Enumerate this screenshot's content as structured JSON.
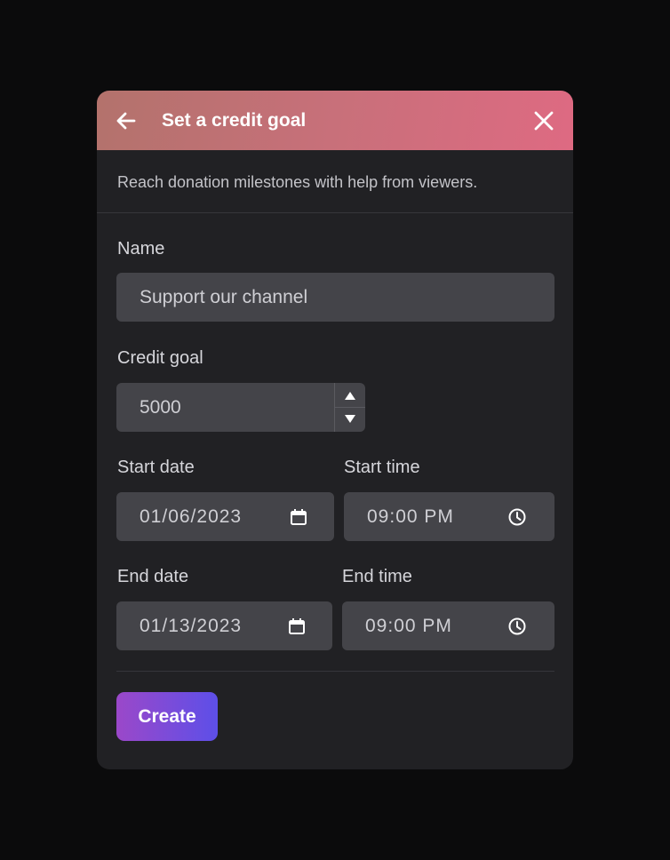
{
  "dialog": {
    "title": "Set a credit goal",
    "description": "Reach donation milestones with help from viewers.",
    "back_icon": "arrow-left-icon",
    "close_icon": "close-icon"
  },
  "form": {
    "name": {
      "label": "Name",
      "value": "Support our channel"
    },
    "credit_goal": {
      "label": "Credit goal",
      "value": "5000"
    },
    "start_date": {
      "label": "Start date",
      "value": "01/06/2023",
      "icon": "calendar-icon"
    },
    "start_time": {
      "label": "Start time",
      "value": "09:00 PM",
      "icon": "clock-icon"
    },
    "end_date": {
      "label": "End date",
      "value": "01/13/2023",
      "icon": "calendar-icon"
    },
    "end_time": {
      "label": "End time",
      "value": "09:00 PM",
      "icon": "clock-icon"
    }
  },
  "actions": {
    "create_label": "Create"
  },
  "colors": {
    "background": "#0b0b0c",
    "dialog": "#212124",
    "header_gradient": [
      "#b3726c",
      "#de6a82"
    ],
    "field": "#444449",
    "button_gradient": [
      "#9b48c9",
      "#5d4fe8"
    ]
  }
}
